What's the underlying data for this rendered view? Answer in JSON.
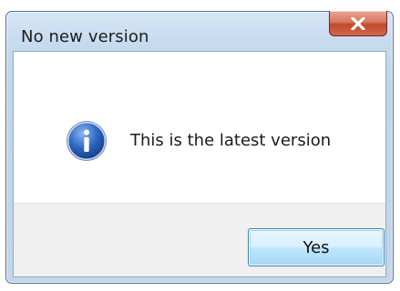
{
  "window": {
    "title": "No new version",
    "close_glyph": "X"
  },
  "message": {
    "icon": "info-icon",
    "text": "This is the latest version"
  },
  "buttons": {
    "yes_label": "Yes"
  },
  "colors": {
    "frame": "#c7dbef",
    "close_button": "#c2482b",
    "button_accent": "#3c7fb1",
    "icon_blue": "#2a5fb0"
  }
}
